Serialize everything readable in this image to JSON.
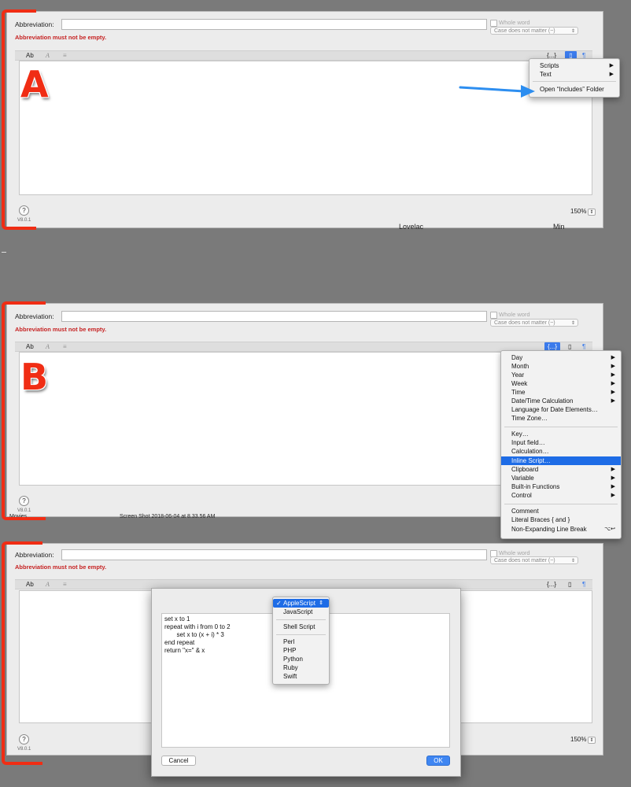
{
  "common": {
    "abbreviation_label": "Abbreviation:",
    "error": "Abbreviation must not be empty.",
    "whole_word": "Whole word",
    "case_option": "Case does not matter (~)",
    "tab_plain": "Ab",
    "tab_rich": "A",
    "tab_format": "≡",
    "macro_btn": "{...}",
    "file_btn": "▯",
    "para_btn": "¶",
    "help": "?",
    "version": "V8.0.1",
    "zoom": "150%",
    "stepper": "⇕"
  },
  "panel_a": {
    "letter": "A",
    "menu": [
      {
        "label": "Scripts",
        "submenu": true
      },
      {
        "label": "Text",
        "submenu": true
      },
      {
        "label": "Open “Includes” Folder",
        "submenu": false
      }
    ],
    "bg_text_1": "Lovelac",
    "bg_text_2": "Min"
  },
  "panel_b": {
    "letter": "B",
    "menu_group1": [
      "Day",
      "Month",
      "Year",
      "Week",
      "Time",
      "Date/Time Calculation",
      "Language for Date Elements…",
      "Time Zone…"
    ],
    "menu_group2": [
      "Key…",
      "Input field…",
      "Calculation…",
      "Inline Script…",
      "Clipboard",
      "Variable",
      "Built-in Functions",
      "Control"
    ],
    "menu_group3": [
      "Comment",
      "Literal Braces { and }",
      "Non-Expanding Line Break"
    ],
    "line_break_shortcut": "⌥↩",
    "highlighted": "Inline Script…",
    "bg_text_1": "Movies",
    "bg_text_2": "Screen Shot 2018-06-04 at 8.33.56 AM"
  },
  "panel_c": {
    "code": "set x to 1\nrepeat with i from 0 to 2\n       set x to (x + i) * 3\nend repeat\nreturn \"x=\" & x",
    "languages_group1": [
      "AppleScript",
      "JavaScript"
    ],
    "languages_group2": [
      "Shell Script"
    ],
    "languages_group3": [
      "Perl",
      "PHP",
      "Python",
      "Ruby",
      "Swift"
    ],
    "selected_language": "AppleScript",
    "cancel": "Cancel",
    "ok": "OK"
  },
  "colors": {
    "accent": "#1e6ce6",
    "error": "#c62222",
    "annotation": "#f02d14",
    "arrow": "#2d8ef0"
  }
}
